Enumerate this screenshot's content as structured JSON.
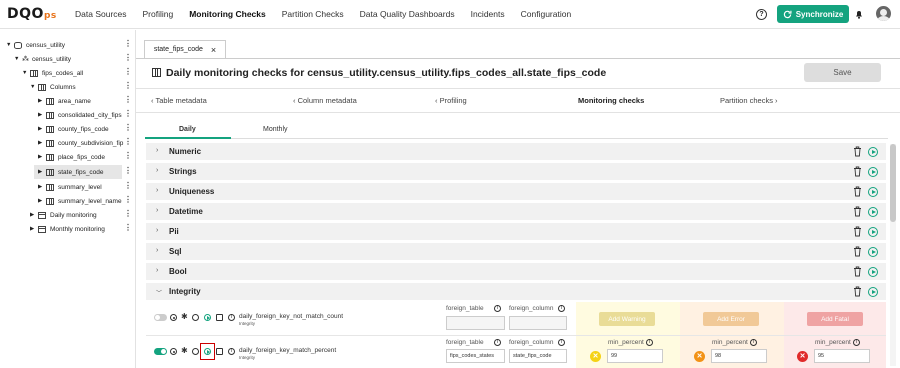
{
  "brand": {
    "logo_main": "DQO",
    "logo_suffix": "ps"
  },
  "nav": {
    "items": [
      "Data Sources",
      "Profiling",
      "Monitoring Checks",
      "Partition Checks",
      "Data Quality Dashboards",
      "Incidents",
      "Configuration"
    ],
    "active": "Monitoring Checks"
  },
  "header": {
    "help": "?",
    "sync_label": "Synchronize"
  },
  "tree": [
    {
      "label": "census_utility",
      "icon": "database-icon",
      "tri": "▼"
    },
    {
      "label": "census_utility",
      "icon": "schema-icon",
      "tri": "▼"
    },
    {
      "label": "fips_codes_all",
      "icon": "table-icon",
      "tri": "▼"
    },
    {
      "label": "Columns",
      "icon": "columns-icon",
      "tri": "▼"
    },
    {
      "label": "area_name",
      "icon": "column-icon",
      "tri": "▶"
    },
    {
      "label": "consolidated_city_fips",
      "icon": "column-icon",
      "tri": "▶"
    },
    {
      "label": "county_fips_code",
      "icon": "column-icon",
      "tri": "▶"
    },
    {
      "label": "county_subdivision_fip",
      "icon": "column-icon",
      "tri": "▶"
    },
    {
      "label": "place_fips_code",
      "icon": "column-icon",
      "tri": "▶"
    },
    {
      "label": "state_fips_code",
      "icon": "column-icon",
      "tri": "▶"
    },
    {
      "label": "summary_level",
      "icon": "column-icon",
      "tri": "▶"
    },
    {
      "label": "summary_level_name",
      "icon": "column-icon",
      "tri": "▶"
    },
    {
      "label": "Daily monitoring",
      "icon": "calendar-icon",
      "tri": "▶"
    },
    {
      "label": "Monthly monitoring",
      "icon": "calendar-icon",
      "tri": "▶"
    }
  ],
  "tab": {
    "label": "state_fips_code",
    "close": "×"
  },
  "page": {
    "title": "Daily monitoring checks for census_utility.census_utility.fips_codes_all.state_fips_code",
    "save_label": "Save"
  },
  "subnav": {
    "table_metadata": "Table metadata",
    "column_metadata": "Column metadata",
    "profiling": "Profiling",
    "monitoring_checks": "Monitoring checks",
    "partition_checks": "Partition checks"
  },
  "modes": {
    "daily": "Daily",
    "monthly": "Monthly"
  },
  "categories": [
    "Numeric",
    "Strings",
    "Uniqueness",
    "Datetime",
    "Pii",
    "Sql",
    "Bool",
    "Integrity"
  ],
  "checks": [
    {
      "name": "daily_foreign_key_not_match_count",
      "category": "Integrity",
      "enabled": false,
      "foreign_table_label": "foreign_table",
      "foreign_table": "",
      "foreign_column_label": "foreign_column",
      "foreign_column": "",
      "warning_label": "Add Warning",
      "error_label": "Add Error",
      "fatal_label": "Add Fatal"
    },
    {
      "name": "daily_foreign_key_match_percent",
      "category": "Integrity",
      "enabled": true,
      "foreign_table_label": "foreign_table",
      "foreign_table": "fips_codes_states",
      "foreign_column_label": "foreign_column",
      "foreign_column": "state_fips_code",
      "warning_param": "min_percent",
      "warning_value": "99",
      "error_param": "min_percent",
      "error_value": "98",
      "fatal_param": "min_percent",
      "fatal_value": "95"
    }
  ],
  "colors": {
    "accent": "#14a37f",
    "warning": "#f5d215",
    "error": "#f29216",
    "fatal": "#e02a2a"
  }
}
